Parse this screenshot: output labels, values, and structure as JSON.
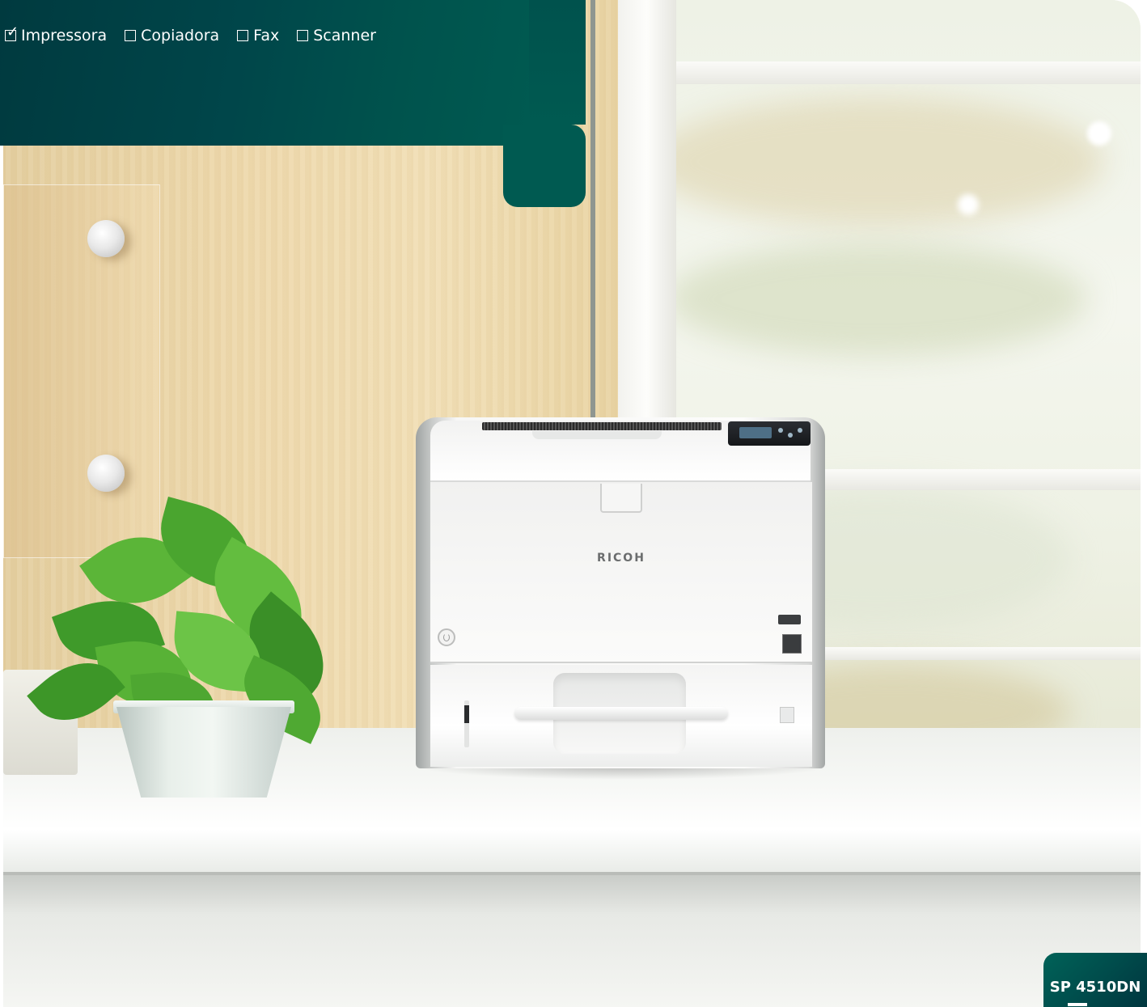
{
  "functions": [
    {
      "label": "Impressora",
      "checked": true
    },
    {
      "label": "Copiadora",
      "checked": false
    },
    {
      "label": "Fax",
      "checked": false
    },
    {
      "label": "Scanner",
      "checked": false
    }
  ],
  "printer": {
    "brand": "RICOH"
  },
  "model": {
    "name": "SP 4510DN"
  },
  "colors": {
    "banner": "#00464a",
    "banner_light": "#005a51",
    "wood": "#eed9ad"
  }
}
